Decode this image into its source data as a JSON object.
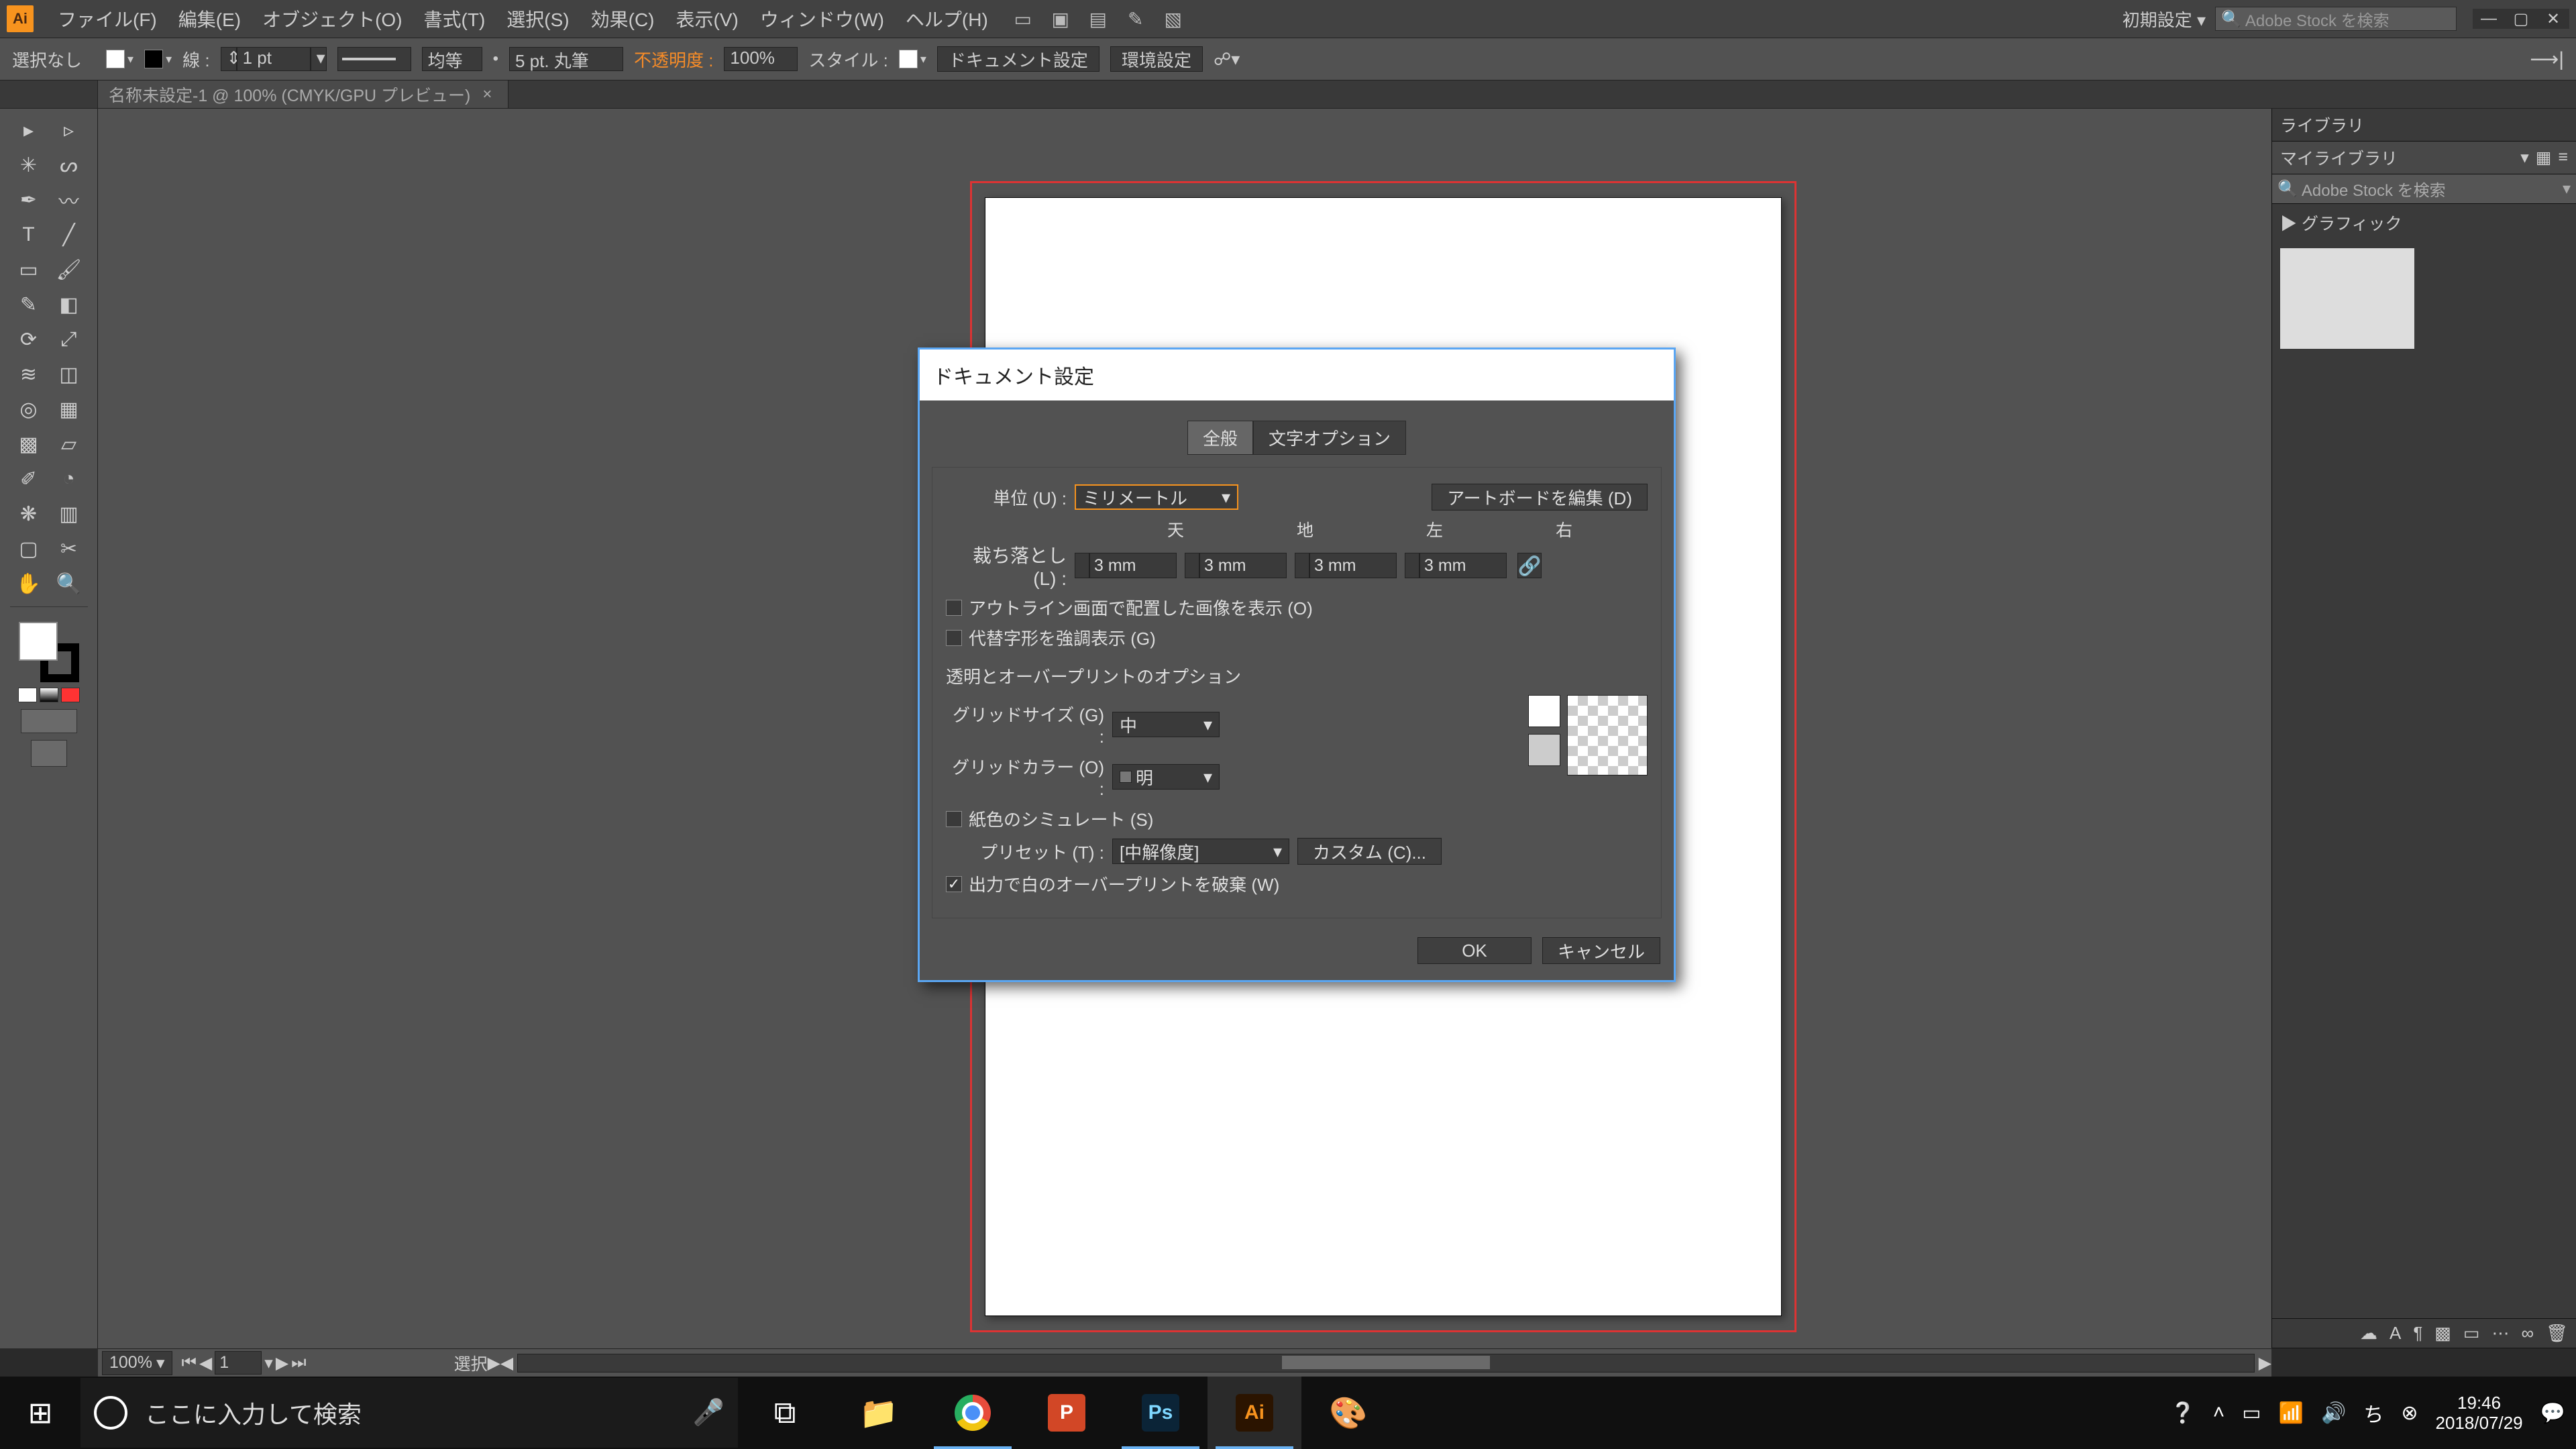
{
  "menubar": {
    "items": [
      "ファイル(F)",
      "編集(E)",
      "オブジェクト(O)",
      "書式(T)",
      "選択(S)",
      "効果(C)",
      "表示(V)",
      "ウィンドウ(W)",
      "ヘルプ(H)"
    ],
    "workspace": "初期設定 ▾",
    "stock_placeholder": "Adobe Stock を検索"
  },
  "controlbar": {
    "no_selection": "選択なし",
    "stroke_label": "線 :",
    "weight": "1 pt",
    "dash_label": "均等",
    "brush": "5 pt. 丸筆",
    "opacity_label": "不透明度 :",
    "opacity": "100%",
    "style_label": "スタイル :",
    "doc_setup_btn": "ドキュメント設定",
    "pref_btn": "環境設定"
  },
  "tabs": {
    "doc": "名称未設定-1 @ 100% (CMYK/GPU プレビュー)"
  },
  "statusbar": {
    "zoom": "100%",
    "page": "1",
    "selection": "選択"
  },
  "library": {
    "tab": "ライブラリ",
    "my": "マイライブラリ",
    "search_placeholder": "Adobe Stock を検索",
    "section": "▶ グラフィック"
  },
  "dialog": {
    "title": "ドキュメント設定",
    "tabs": {
      "general": "全般",
      "type": "文字オプション"
    },
    "units_label": "単位 (U) :",
    "units_value": "ミリメートル",
    "edit_artboards": "アートボードを編集 (D)",
    "bleed": {
      "label": "裁ち落とし (L) :",
      "headers": {
        "top": "天",
        "bottom": "地",
        "left": "左",
        "right": "右"
      },
      "top": "3 mm",
      "bottom": "3 mm",
      "left": "3 mm",
      "right": "3 mm"
    },
    "outline_images": "アウトライン画面で配置した画像を表示 (O)",
    "alt_glyphs": "代替字形を強調表示 (G)",
    "transparency_header": "透明とオーバープリントのオプション",
    "grid_size_label": "グリッドサイズ (G) :",
    "grid_size": "中",
    "grid_color_label": "グリッドカラー (O) :",
    "grid_color": "明",
    "simulate_paper": "紙色のシミュレート (S)",
    "preset_label": "プリセット (T) :",
    "preset_value": "[中解像度]",
    "custom": "カスタム (C)...",
    "discard_white": "出力で白のオーバープリントを破棄 (W)",
    "ok": "OK",
    "cancel": "キャンセル"
  },
  "taskbar": {
    "search": "ここに入力して検索",
    "clock": {
      "time": "19:46",
      "date": "2018/07/29"
    }
  }
}
